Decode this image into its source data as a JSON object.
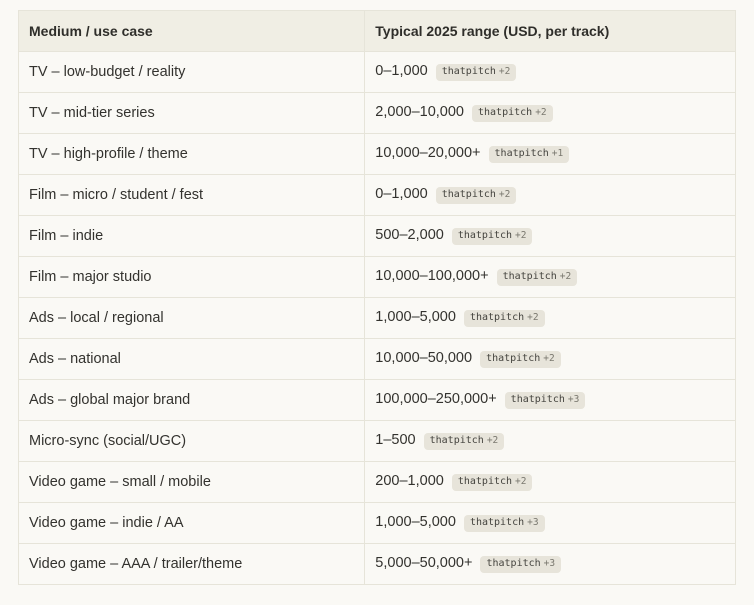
{
  "colors": {
    "page_background": "#faf9f5",
    "header_background": "#f0eee4",
    "border": "#e6e4d9",
    "chip_background": "#e7e4da",
    "text": "#33322e"
  },
  "table": {
    "headers": [
      "Medium / use case",
      "Typical 2025 range (USD, per track)"
    ],
    "rows": [
      {
        "medium": "TV – low-budget / reality",
        "range": "0–1,000",
        "source": "thatpitch",
        "count": "+2"
      },
      {
        "medium": "TV – mid-tier series",
        "range": "2,000–10,000",
        "source": "thatpitch",
        "count": "+2"
      },
      {
        "medium": "TV – high-profile / theme",
        "range": "10,000–20,000+",
        "source": "thatpitch",
        "count": "+1"
      },
      {
        "medium": "Film – micro / student / fest",
        "range": "0–1,000",
        "source": "thatpitch",
        "count": "+2"
      },
      {
        "medium": "Film – indie",
        "range": "500–2,000",
        "source": "thatpitch",
        "count": "+2"
      },
      {
        "medium": "Film – major studio",
        "range": "10,000–100,000+",
        "source": "thatpitch",
        "count": "+2"
      },
      {
        "medium": "Ads – local / regional",
        "range": "1,000–5,000",
        "source": "thatpitch",
        "count": "+2"
      },
      {
        "medium": "Ads – national",
        "range": "10,000–50,000",
        "source": "thatpitch",
        "count": "+2"
      },
      {
        "medium": "Ads – global major brand",
        "range": "100,000–250,000+",
        "source": "thatpitch",
        "count": "+3"
      },
      {
        "medium": "Micro-sync (social/UGC)",
        "range": "1–500",
        "source": "thatpitch",
        "count": "+2"
      },
      {
        "medium": "Video game – small / mobile",
        "range": "200–1,000",
        "source": "thatpitch",
        "count": "+2"
      },
      {
        "medium": "Video game – indie / AA",
        "range": "1,000–5,000",
        "source": "thatpitch",
        "count": "+3"
      },
      {
        "medium": "Video game – AAA / trailer/theme",
        "range": "5,000–50,000+",
        "source": "thatpitch",
        "count": "+3"
      }
    ]
  }
}
